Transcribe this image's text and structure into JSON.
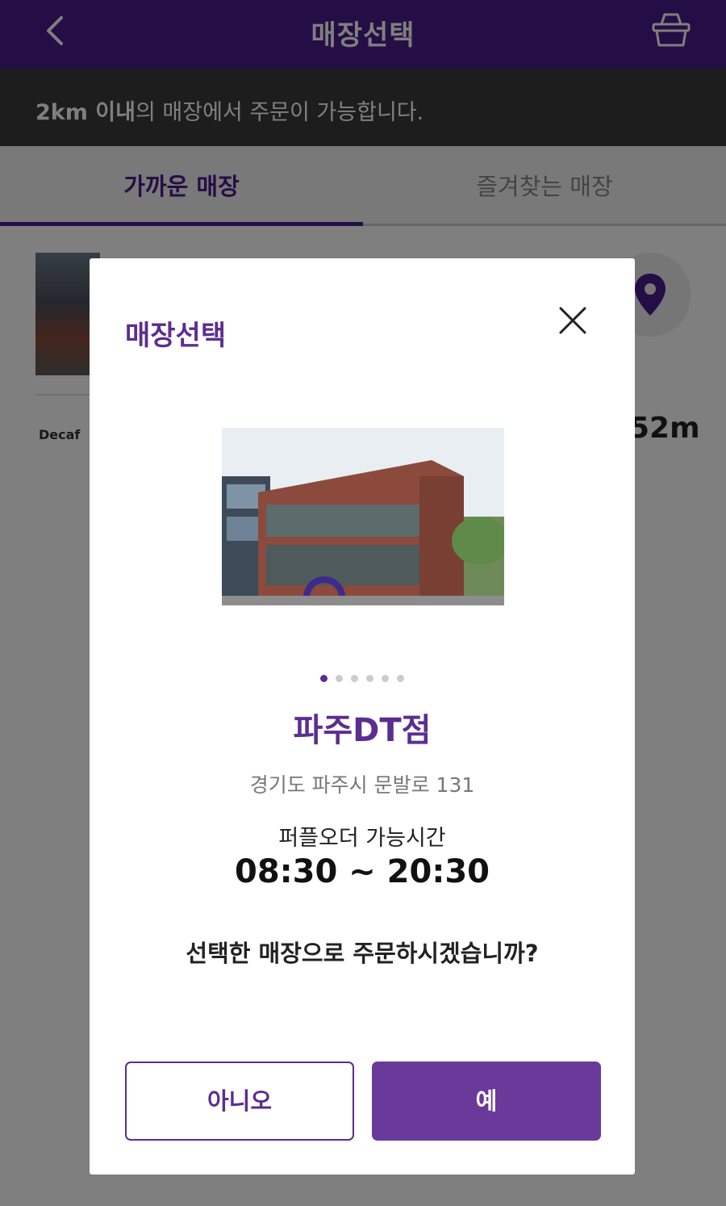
{
  "header": {
    "title": "매장선택",
    "back_icon": "chevron-left-icon",
    "basket_icon": "basket-icon"
  },
  "notice": {
    "bold_part": "2km 이내",
    "rest": "의 매장에서 주문이 가능합니다."
  },
  "tabs": [
    {
      "label": "가까운 매장",
      "active": true
    },
    {
      "label": "즐겨찾는 매장",
      "active": false
    }
  ],
  "store_list": {
    "badge": "Decaf",
    "distance_partial": "52m",
    "map_icon": "map-pin-icon"
  },
  "modal": {
    "title": "매장선택",
    "close_icon": "close-icon",
    "photo_count": 6,
    "photo_index": 1,
    "store_name": "파주DT점",
    "address": "경기도 파주시 문발로 131",
    "hours_label": "퍼플오더 가능시간",
    "hours_value": "08:30 ~ 20:30",
    "question": "선택한 매장으로 주문하시겠습니까?",
    "no_label": "아니오",
    "yes_label": "예"
  },
  "colors": {
    "brand_purple": "#5c2d91",
    "header_purple": "#4a1d8a",
    "notice_bg": "#3a3a3a"
  }
}
